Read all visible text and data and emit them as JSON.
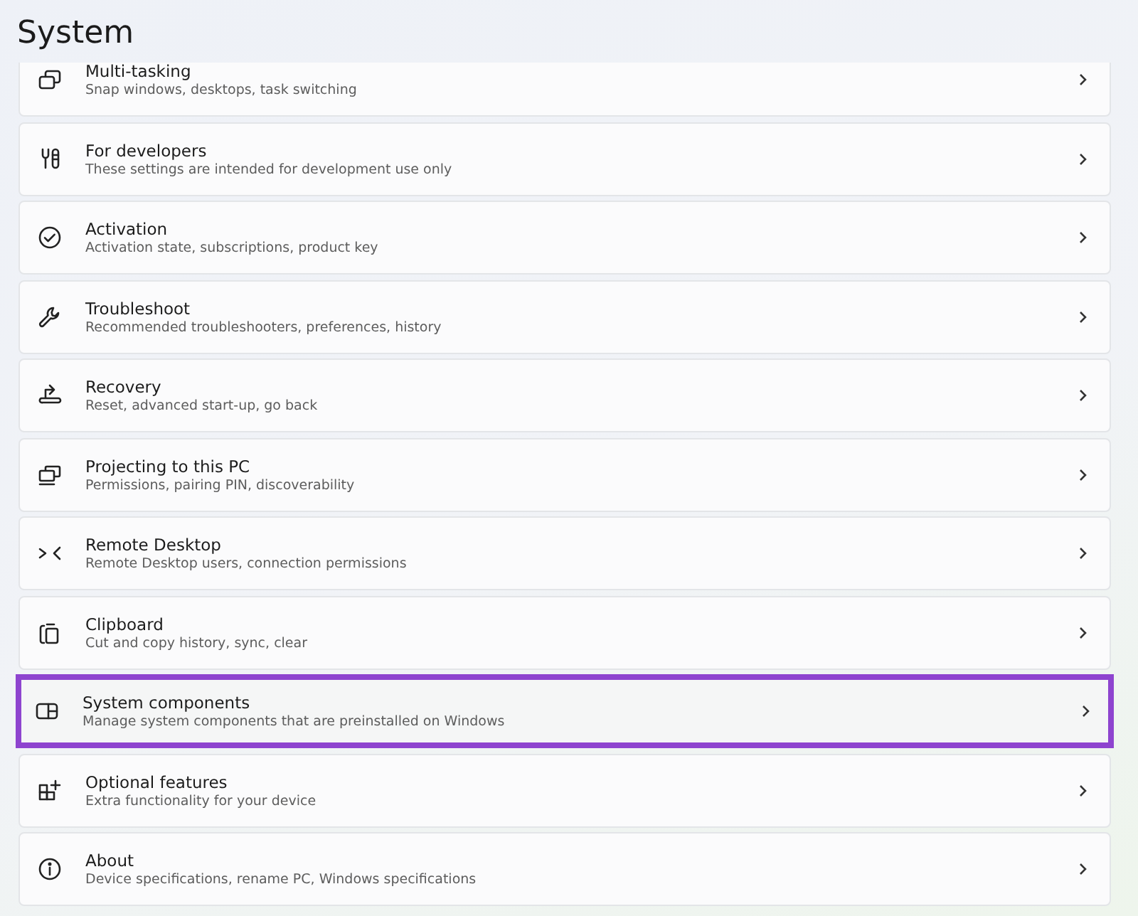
{
  "header": {
    "title": "System"
  },
  "items": [
    {
      "title": "Multi-tasking",
      "subtitle": "Snap windows, desktops, task switching",
      "highlighted": false
    },
    {
      "title": "For developers",
      "subtitle": "These settings are intended for development use only",
      "highlighted": false
    },
    {
      "title": "Activation",
      "subtitle": "Activation state, subscriptions, product key",
      "highlighted": false
    },
    {
      "title": "Troubleshoot",
      "subtitle": "Recommended troubleshooters, preferences, history",
      "highlighted": false
    },
    {
      "title": "Recovery",
      "subtitle": "Reset, advanced start-up, go back",
      "highlighted": false
    },
    {
      "title": "Projecting to this PC",
      "subtitle": "Permissions, pairing PIN, discoverability",
      "highlighted": false
    },
    {
      "title": "Remote Desktop",
      "subtitle": "Remote Desktop users, connection permissions",
      "highlighted": false
    },
    {
      "title": "Clipboard",
      "subtitle": "Cut and copy history, sync, clear",
      "highlighted": false
    },
    {
      "title": "System components",
      "subtitle": "Manage system components that are preinstalled on Windows",
      "highlighted": true
    },
    {
      "title": "Optional features",
      "subtitle": "Extra functionality for your device",
      "highlighted": false
    },
    {
      "title": "About",
      "subtitle": "Device specifications, rename PC, Windows specifications",
      "highlighted": false
    }
  ]
}
